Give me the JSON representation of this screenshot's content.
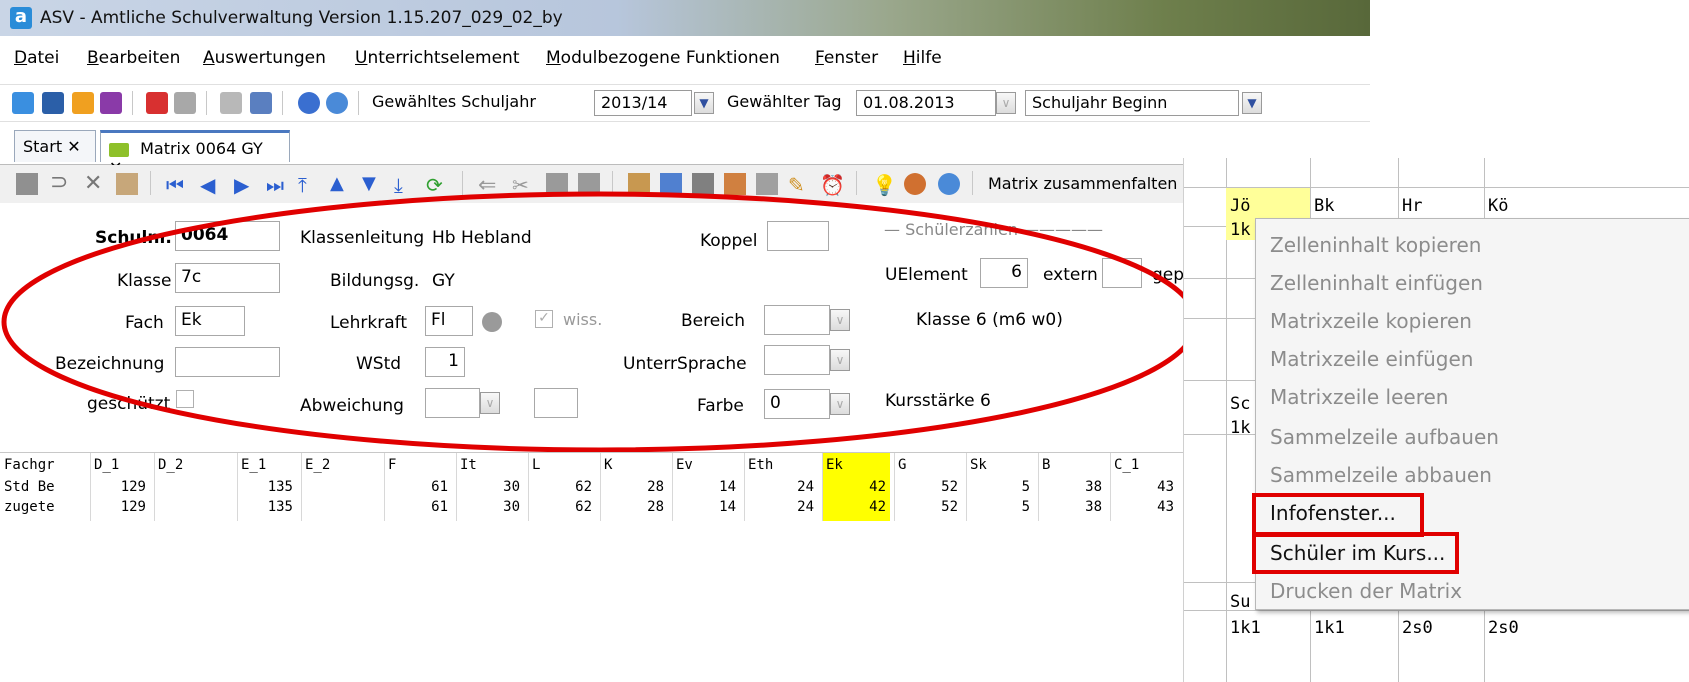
{
  "window": {
    "title": "ASV - Amtliche Schulverwaltung Version 1.15.207_029_02_by",
    "logo": "a"
  },
  "menu": [
    "Datei",
    "Bearbeiten",
    "Auswertungen",
    "Unterrichtselement",
    "Modulbezogene Funktionen",
    "Fenster",
    "Hilfe"
  ],
  "toolbar": {
    "schuljahr_label": "Gewähltes Schuljahr",
    "schuljahr_value": "2013/14",
    "tag_label": "Gewählter Tag",
    "tag_value": "01.08.2013",
    "preset_value": "Schuljahr Beginn"
  },
  "tabs": [
    {
      "label": "Start",
      "close": "✕"
    },
    {
      "label": "Matrix 0064 GY",
      "close": "✕"
    }
  ],
  "toolbar2": {
    "collapse_label": "Matrix zusammenfalten"
  },
  "form": {
    "schulnr_label": "Schulnr.",
    "schulnr_value": "0064",
    "klassenleitung_label": "Klassenleitung",
    "klassenleitung_value": "Hb Hebland",
    "koppel_label": "Koppel",
    "koppel_value": "",
    "schuelerzahlen_label": "Schülerzahlen",
    "klasse_label": "Klasse",
    "klasse_value": "7c",
    "bildungsg_label": "Bildungsg.",
    "bildungsg_value": "GY",
    "uelement_label": "UElement",
    "uelement_value": "6",
    "extern_label": "extern",
    "extern_value": "",
    "gep_label": "gep",
    "fach_label": "Fach",
    "fach_value": "Ek",
    "lehrkraft_label": "Lehrkraft",
    "lehrkraft_value": "Fl",
    "wiss_label": "wiss.",
    "wiss_checked": true,
    "bereich_label": "Bereich",
    "bereich_value": "",
    "klasse_info": "Klasse 6 (m6 w0)",
    "bezeichnung_label": "Bezeichnung",
    "bezeichnung_value": "",
    "wstd_label": "WStd",
    "wstd_value": "1",
    "unterrsprache_label": "UnterrSprache",
    "unterrsprache_value": "",
    "geschuetzt_label": "geschützt",
    "abweichung_label": "Abweichung",
    "abweichung_value": "",
    "farbe_label": "Farbe",
    "farbe_value": "0",
    "kursstaerke_text": "Kursstärke 6"
  },
  "grid": {
    "columns": [
      "Fachgr",
      "D_1",
      "D_2",
      "E_1",
      "E_2",
      "F",
      "It",
      "L",
      "K",
      "Ev",
      "Eth",
      "Ek",
      "G",
      "Sk",
      "B",
      "C_1"
    ],
    "rows": [
      {
        "label": "Std Be",
        "values": [
          "129",
          "",
          "135",
          "",
          "61",
          "30",
          "62",
          "28",
          "14",
          "24",
          "42",
          "52",
          "5",
          "38",
          "43"
        ]
      },
      {
        "label": "zugete",
        "values": [
          "129",
          "",
          "135",
          "",
          "61",
          "30",
          "62",
          "28",
          "14",
          "24",
          "42",
          "52",
          "5",
          "38",
          "43"
        ]
      }
    ],
    "highlight_column": "Ek",
    "highlight_color": "#ffff00"
  },
  "matrix": {
    "header": [
      "Jö",
      "Bk",
      "Hr",
      "Kö"
    ],
    "row1_first": "1k",
    "row_sc": "Sc",
    "row_sc2": "1k",
    "row_su": "Su",
    "bottom": [
      "1k1",
      "1k1",
      "2s0",
      "2s0"
    ]
  },
  "context_menu": [
    {
      "label": "Zelleninhalt kopieren",
      "enabled": false
    },
    {
      "label": "Zelleninhalt einfügen",
      "enabled": false
    },
    {
      "label": "Matrixzeile kopieren",
      "enabled": false
    },
    {
      "label": "Matrixzeile einfügen",
      "enabled": false
    },
    {
      "label": "Matrixzeile leeren",
      "enabled": false
    },
    {
      "label": "Sammelzeile aufbauen",
      "enabled": false
    },
    {
      "label": "Sammelzeile abbauen",
      "enabled": false
    },
    {
      "label": "Infofenster...",
      "enabled": true
    },
    {
      "label": "Schüler im Kurs...",
      "enabled": true
    },
    {
      "label": "Drucken der Matrix",
      "enabled": false
    }
  ],
  "colors": {
    "annotation_red": "#e00000",
    "highlight_yellow": "#ffff00",
    "accent_blue": "#4a78c0"
  }
}
